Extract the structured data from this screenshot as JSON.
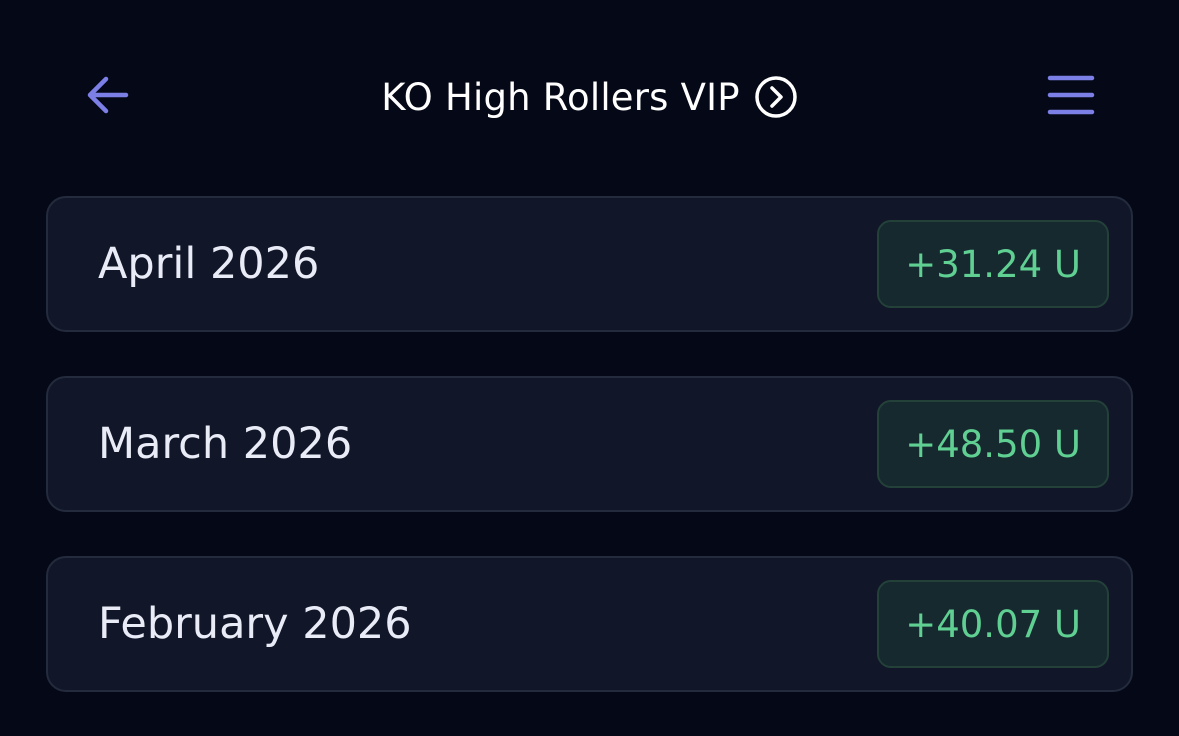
{
  "header": {
    "title": "KO High Rollers VIP",
    "back_icon": "arrow-left-icon",
    "info_icon": "chevron-right-circle-icon",
    "menu_icon": "hamburger-menu-icon"
  },
  "months": [
    {
      "label": "April 2026",
      "units": "+31.24 U"
    },
    {
      "label": "March 2026",
      "units": "+48.50 U"
    },
    {
      "label": "February 2026",
      "units": "+40.07 U"
    }
  ],
  "colors": {
    "background": "#050816",
    "card": "#111729",
    "card_border": "#232b3d",
    "accent": "#7b7fe6",
    "positive": "#5fcf92",
    "badge_bg": "#15292f"
  }
}
